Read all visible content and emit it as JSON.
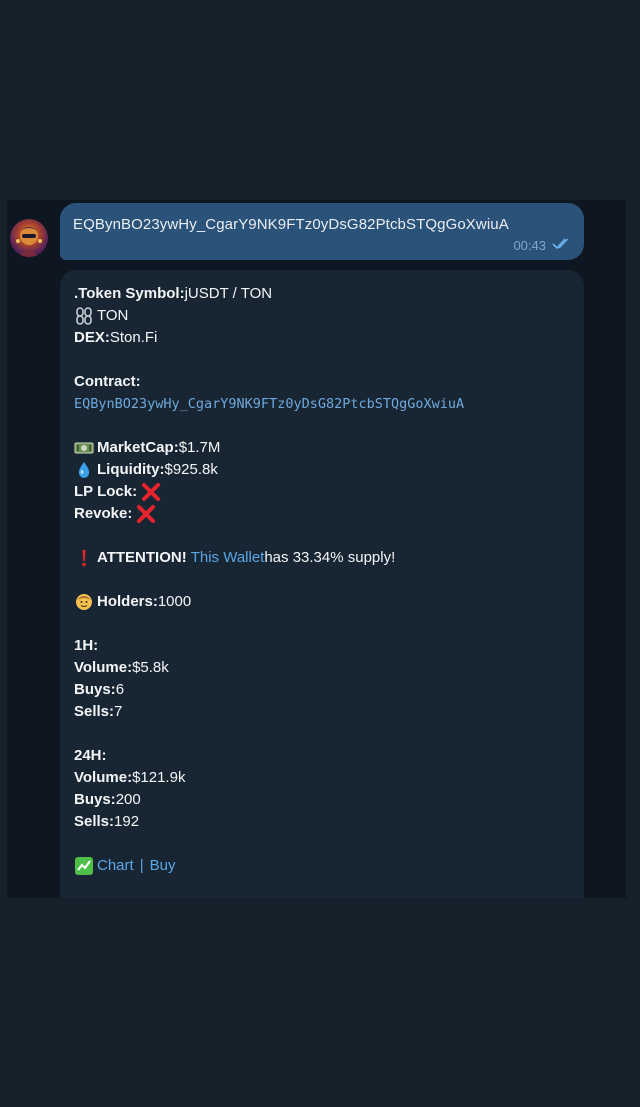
{
  "outgoing": {
    "text": "EQBynBO23ywHy_CgarY9NK9FTz0yDsG82PtcbSTQgGoXwiuA",
    "time": "00:43",
    "status_icon": "double-check-icon"
  },
  "avatar": {
    "icon": "user-avatar"
  },
  "token": {
    "symbol_label": ".Token Symbol:",
    "symbol_value": " jUSDT / TON",
    "chain_icon": "chain-link-icon",
    "chain_value": " TON",
    "dex_label": "DEX:",
    "dex_value": " Ston.Fi"
  },
  "contract": {
    "label": "Contract:",
    "address": "EQBynBO23ywHy_CgarY9NK9FTz0yDsG82PtcbSTQgGoXwiuA"
  },
  "stats": {
    "marketcap_icon": "money-icon",
    "marketcap_label": "MarketCap:",
    "marketcap_value": " $1.7M",
    "liquidity_icon": "droplet-icon",
    "liquidity_label": "Liquidity:",
    "liquidity_value": " $925.8k",
    "lp_lock_label": "LP Lock:",
    "revoke_label": "Revoke:",
    "cross_icon": "red-cross-icon"
  },
  "attention": {
    "icon": "exclamation-icon",
    "label": "ATTENTION!",
    "link_text": "This Wallet",
    "rest": " has 33.34% supply!"
  },
  "holders": {
    "icon": "person-icon",
    "label": "Holders:",
    "value": " 1000"
  },
  "h1": {
    "title": "1H:",
    "volume_label": "Volume:",
    "volume_value": " $5.8k",
    "buys_label": "Buys:",
    "buys_value": " 6",
    "sells_label": "Sells:",
    "sells_value": " 7"
  },
  "h24": {
    "title": "24H:",
    "volume_label": "Volume:",
    "volume_value": " $121.9k",
    "buys_label": "Buys:",
    "buys_value": " 200",
    "sells_label": "Sells:",
    "sells_value": " 192"
  },
  "links": {
    "chart_icon": "chart-icon",
    "chart": "Chart",
    "separator": "|",
    "buy": "Buy"
  }
}
